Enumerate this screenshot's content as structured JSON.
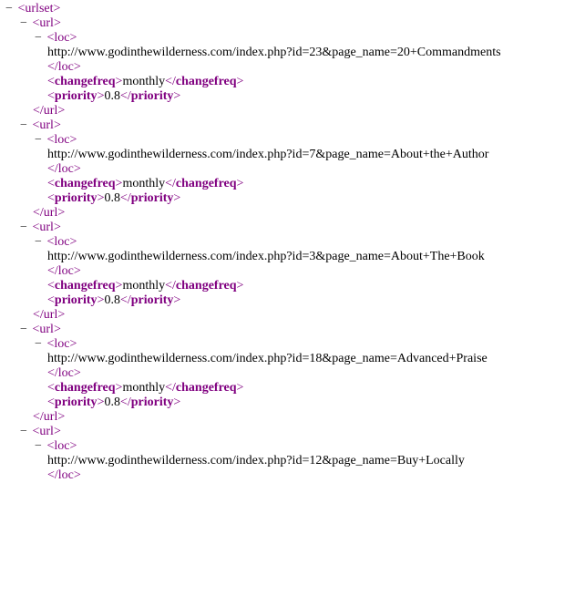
{
  "tags": {
    "urlset": "urlset",
    "url": "url",
    "loc": "loc",
    "changefreq": "changefreq",
    "priority": "priority"
  },
  "entries": [
    {
      "loc": "http://www.godinthewilderness.com/index.php?id=23&page_name=20+Commandments",
      "changefreq": "monthly",
      "priority": "0.8"
    },
    {
      "loc": "http://www.godinthewilderness.com/index.php?id=7&page_name=About+the+Author",
      "changefreq": "monthly",
      "priority": "0.8"
    },
    {
      "loc": "http://www.godinthewilderness.com/index.php?id=3&page_name=About+The+Book",
      "changefreq": "monthly",
      "priority": "0.8"
    },
    {
      "loc": "http://www.godinthewilderness.com/index.php?id=18&page_name=Advanced+Praise",
      "changefreq": "monthly",
      "priority": "0.8"
    }
  ],
  "last": {
    "loc": "http://www.godinthewilderness.com/index.php?id=12&page_name=Buy+Locally"
  },
  "toggle": "−"
}
